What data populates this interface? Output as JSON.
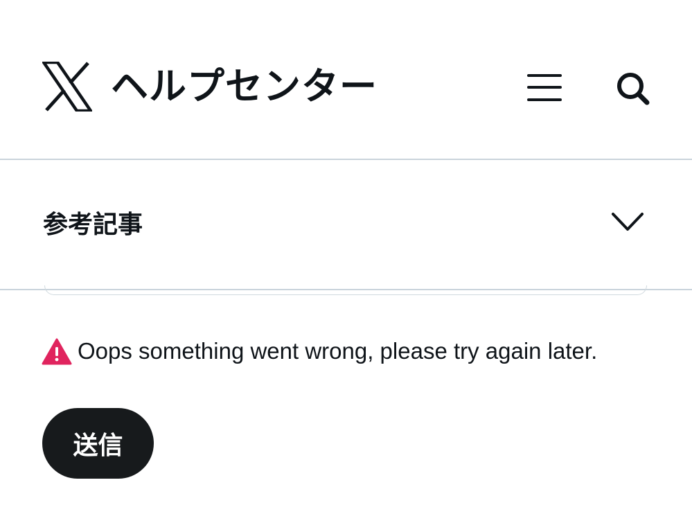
{
  "header": {
    "logo_icon": "x-logo-icon",
    "title": "ヘルプセンター",
    "menu_icon": "hamburger-menu-icon",
    "search_icon": "search-icon"
  },
  "accordion": {
    "label": "参考記事",
    "chevron_icon": "chevron-down-icon"
  },
  "error": {
    "icon": "warning-icon",
    "message": "Oops something went wrong, please try again later.",
    "icon_color": "#e0245e"
  },
  "form": {
    "submit_label": "送信",
    "submit_bg": "#171a1c"
  },
  "colors": {
    "divider": "#c9d3db",
    "text": "#0f1419"
  }
}
